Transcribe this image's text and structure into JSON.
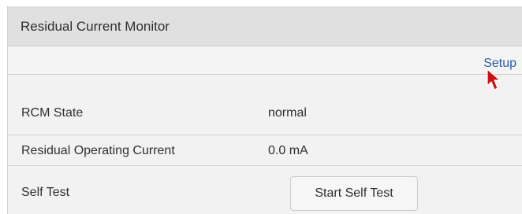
{
  "panel": {
    "title": "Residual Current Monitor",
    "setup_link": "Setup"
  },
  "rows": [
    {
      "label": "RCM State",
      "value": "normal"
    },
    {
      "label": "Residual Operating Current",
      "value": "0.0 mA"
    },
    {
      "label": "Self Test",
      "button": "Start Self Test"
    }
  ],
  "colors": {
    "link": "#2b5aa6",
    "cursor": "#cc1111",
    "header_bg": "#e0e0e0",
    "panel_bg": "#f2f2f2"
  },
  "icons": {
    "cursor": "mouse-pointer-icon"
  }
}
